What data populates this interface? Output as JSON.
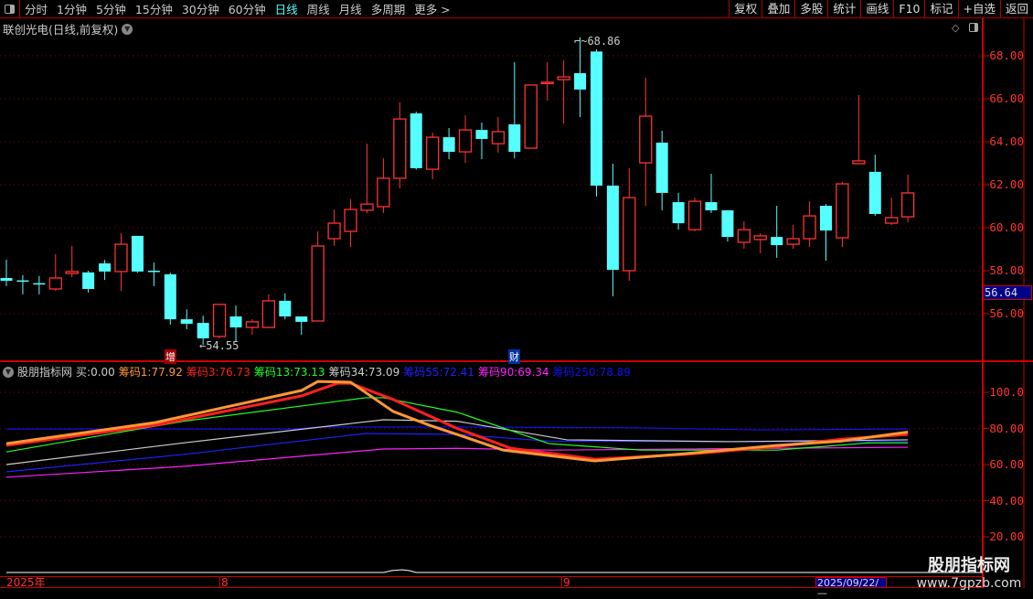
{
  "toolbar": {
    "periods": [
      "分时",
      "1分钟",
      "5分钟",
      "15分钟",
      "30分钟",
      "60分钟",
      "日线",
      "周线",
      "月线",
      "多周期",
      "更多 >"
    ],
    "active": "日线",
    "right_buttons": [
      "复权",
      "叠加",
      "多股",
      "统计",
      "画线",
      "F10",
      "标记",
      "+自选",
      "返回"
    ]
  },
  "chart_title": "联创光电(日线,前复权)",
  "price_axis": [
    "68.00",
    "66.00",
    "64.00",
    "62.00",
    "60.00",
    "58.00",
    "56.00"
  ],
  "current_price": "56.64",
  "high_label": "68.86",
  "low_label": "54.55",
  "markers": [
    {
      "text": "增",
      "color": "#a00000"
    },
    {
      "text": "财",
      "color": "#0030a0"
    }
  ],
  "indicator": {
    "name": "股朋指标网",
    "buy_label": "买:",
    "buy_value": "0.00",
    "legend": [
      {
        "label": "筹码1:",
        "value": "77.92",
        "color": "#ff9933"
      },
      {
        "label": "筹码3:",
        "value": "76.73",
        "color": "#ff2020"
      },
      {
        "label": "筹码13:",
        "value": "73.13",
        "color": "#20ff20"
      },
      {
        "label": "筹码34:",
        "value": "73.09",
        "color": "#cccccc"
      },
      {
        "label": "筹码55:",
        "value": "72.41",
        "color": "#2020ff"
      },
      {
        "label": "筹码90:",
        "value": "69.34",
        "color": "#ff20ff"
      },
      {
        "label": "筹码250:",
        "value": "78.89",
        "color": "#1010ee"
      }
    ],
    "axis": [
      "100.0",
      "80.00",
      "60.00",
      "40.00",
      "20.00"
    ]
  },
  "date_bar": {
    "year": "2025年",
    "months": [
      "8",
      "9"
    ],
    "current_date": "2025/09/22/—"
  },
  "watermark": {
    "title": "股朋指标网",
    "url": "www.7gpzb.com"
  },
  "colors": {
    "up": "#ff3333",
    "down": "#55ffff",
    "grid": "#8b0000"
  },
  "chart_data": {
    "type": "candlestick",
    "ylim": [
      54,
      69
    ],
    "ohlc": [
      [
        57.66,
        58.51,
        57.28,
        57.53
      ],
      [
        57.55,
        57.8,
        56.9,
        57.5
      ],
      [
        57.42,
        57.75,
        56.9,
        57.38
      ],
      [
        57.15,
        58.77,
        57.06,
        57.66
      ],
      [
        57.87,
        59.15,
        57.7,
        57.96
      ],
      [
        57.92,
        58.0,
        56.98,
        57.15
      ],
      [
        58.34,
        58.5,
        57.57,
        57.96
      ],
      [
        57.96,
        59.74,
        57.06,
        59.23
      ],
      [
        59.62,
        59.62,
        57.9,
        57.96
      ],
      [
        58.0,
        58.38,
        57.28,
        57.96
      ],
      [
        57.83,
        57.91,
        55.49,
        55.74
      ],
      [
        55.74,
        56.2,
        55.28,
        55.53
      ],
      [
        55.57,
        55.91,
        54.55,
        54.85
      ],
      [
        54.94,
        56.47,
        54.85,
        56.43
      ],
      [
        55.87,
        56.38,
        54.68,
        55.36
      ],
      [
        55.36,
        55.74,
        55.02,
        55.62
      ],
      [
        55.36,
        56.89,
        55.36,
        56.6
      ],
      [
        56.6,
        56.94,
        55.74,
        55.87
      ],
      [
        55.87,
        55.87,
        55.02,
        55.62
      ],
      [
        55.66,
        59.83,
        55.66,
        59.15
      ],
      [
        59.49,
        60.85,
        59.15,
        60.21
      ],
      [
        59.83,
        61.32,
        59.1,
        60.85
      ],
      [
        60.81,
        63.91,
        60.68,
        61.1
      ],
      [
        60.98,
        63.23,
        60.68,
        62.3
      ],
      [
        62.3,
        65.83,
        61.83,
        65.06
      ],
      [
        65.32,
        65.4,
        62.7,
        62.77
      ],
      [
        62.72,
        64.43,
        62.26,
        64.21
      ],
      [
        64.21,
        64.64,
        63.19,
        63.53
      ],
      [
        63.53,
        65.23,
        63.02,
        64.55
      ],
      [
        64.55,
        64.89,
        63.19,
        64.13
      ],
      [
        63.91,
        65.15,
        63.49,
        64.47
      ],
      [
        64.81,
        67.7,
        63.23,
        63.53
      ],
      [
        63.7,
        66.64,
        63.7,
        66.64
      ],
      [
        66.75,
        67.7,
        65.91,
        66.77
      ],
      [
        66.89,
        67.79,
        64.85,
        67.02
      ],
      [
        67.19,
        68.86,
        65.15,
        66.43
      ],
      [
        68.2,
        68.3,
        61.45,
        61.96
      ],
      [
        61.96,
        62.98,
        56.81,
        58.04
      ],
      [
        58.0,
        62.77,
        57.53,
        61.4
      ],
      [
        63.02,
        66.98,
        61.02,
        65.19
      ],
      [
        63.96,
        64.51,
        60.81,
        61.62
      ],
      [
        61.19,
        61.62,
        59.91,
        60.21
      ],
      [
        59.91,
        61.4,
        59.83,
        61.23
      ],
      [
        61.19,
        62.51,
        60.68,
        60.81
      ],
      [
        60.81,
        60.81,
        59.36,
        59.57
      ],
      [
        59.32,
        60.3,
        59.02,
        59.91
      ],
      [
        59.45,
        59.74,
        58.81,
        59.62
      ],
      [
        59.57,
        61.02,
        58.6,
        59.19
      ],
      [
        59.23,
        60.13,
        59.02,
        59.49
      ],
      [
        59.49,
        61.23,
        59.1,
        60.55
      ],
      [
        61.02,
        61.1,
        58.47,
        59.87
      ],
      [
        59.53,
        62.13,
        59.1,
        62.04
      ],
      [
        62.98,
        66.17,
        62.98,
        63.11
      ],
      [
        62.6,
        63.4,
        60.55,
        60.64
      ],
      [
        60.21,
        61.4,
        60.13,
        60.47
      ],
      [
        60.51,
        62.47,
        60.26,
        61.62
      ]
    ],
    "indicator_series": [
      {
        "name": "筹码250",
        "color": "#1010ee",
        "points": [
          [
            0,
            79.7
          ],
          [
            17.5,
            79.7
          ],
          [
            19.1,
            80.8
          ],
          [
            27.5,
            80.8
          ],
          [
            38.7,
            80.3
          ],
          [
            45.9,
            79.2
          ],
          [
            55,
            79.7
          ]
        ]
      },
      {
        "name": "筹码90",
        "color": "#ff20ff",
        "points": [
          [
            0,
            53
          ],
          [
            10.8,
            59
          ],
          [
            23,
            68.6
          ],
          [
            27.5,
            69
          ],
          [
            33.1,
            68
          ],
          [
            55,
            69.6
          ]
        ]
      },
      {
        "name": "筹码55",
        "color": "#2020ff",
        "points": [
          [
            0,
            56
          ],
          [
            10.8,
            65.6
          ],
          [
            21.9,
            77.2
          ],
          [
            27.5,
            76.7
          ],
          [
            33.1,
            73
          ],
          [
            44.2,
            72.7
          ],
          [
            55,
            72.7
          ]
        ]
      },
      {
        "name": "筹码34",
        "color": "#cccccc",
        "points": [
          [
            0,
            60
          ],
          [
            10.8,
            72
          ],
          [
            23,
            84.8
          ],
          [
            27.5,
            84
          ],
          [
            34.2,
            73.7
          ],
          [
            44.2,
            72.7
          ],
          [
            55,
            73.7
          ]
        ]
      },
      {
        "name": "筹码13",
        "color": "#20ff20",
        "points": [
          [
            0,
            67
          ],
          [
            10.8,
            84
          ],
          [
            21.9,
            97
          ],
          [
            23,
            97
          ],
          [
            27.5,
            89
          ],
          [
            33.1,
            71.6
          ],
          [
            38.7,
            68
          ],
          [
            47,
            68
          ],
          [
            52.6,
            72
          ],
          [
            55,
            72
          ]
        ]
      },
      {
        "name": "筹码3",
        "color": "#ff2020",
        "points": [
          [
            0,
            70.6
          ],
          [
            9.1,
            81.8
          ],
          [
            18,
            98
          ],
          [
            20.2,
            105
          ],
          [
            21,
            105
          ],
          [
            23.6,
            96
          ],
          [
            27.5,
            80
          ],
          [
            30.8,
            69
          ],
          [
            35.9,
            63
          ],
          [
            41.4,
            65.6
          ],
          [
            47,
            70
          ],
          [
            50.9,
            74
          ],
          [
            55,
            76.7
          ]
        ]
      },
      {
        "name": "筹码1",
        "color": "#ff9933",
        "points": [
          [
            0,
            71.6
          ],
          [
            9.1,
            83.3
          ],
          [
            18,
            101
          ],
          [
            19,
            106
          ],
          [
            21,
            105.6
          ],
          [
            23.6,
            89.4
          ],
          [
            25.8,
            81.8
          ],
          [
            27.5,
            76.7
          ],
          [
            30.3,
            68
          ],
          [
            35.9,
            62
          ],
          [
            41.4,
            66
          ],
          [
            47,
            70.6
          ],
          [
            50.9,
            73
          ],
          [
            55,
            78
          ]
        ]
      }
    ]
  }
}
